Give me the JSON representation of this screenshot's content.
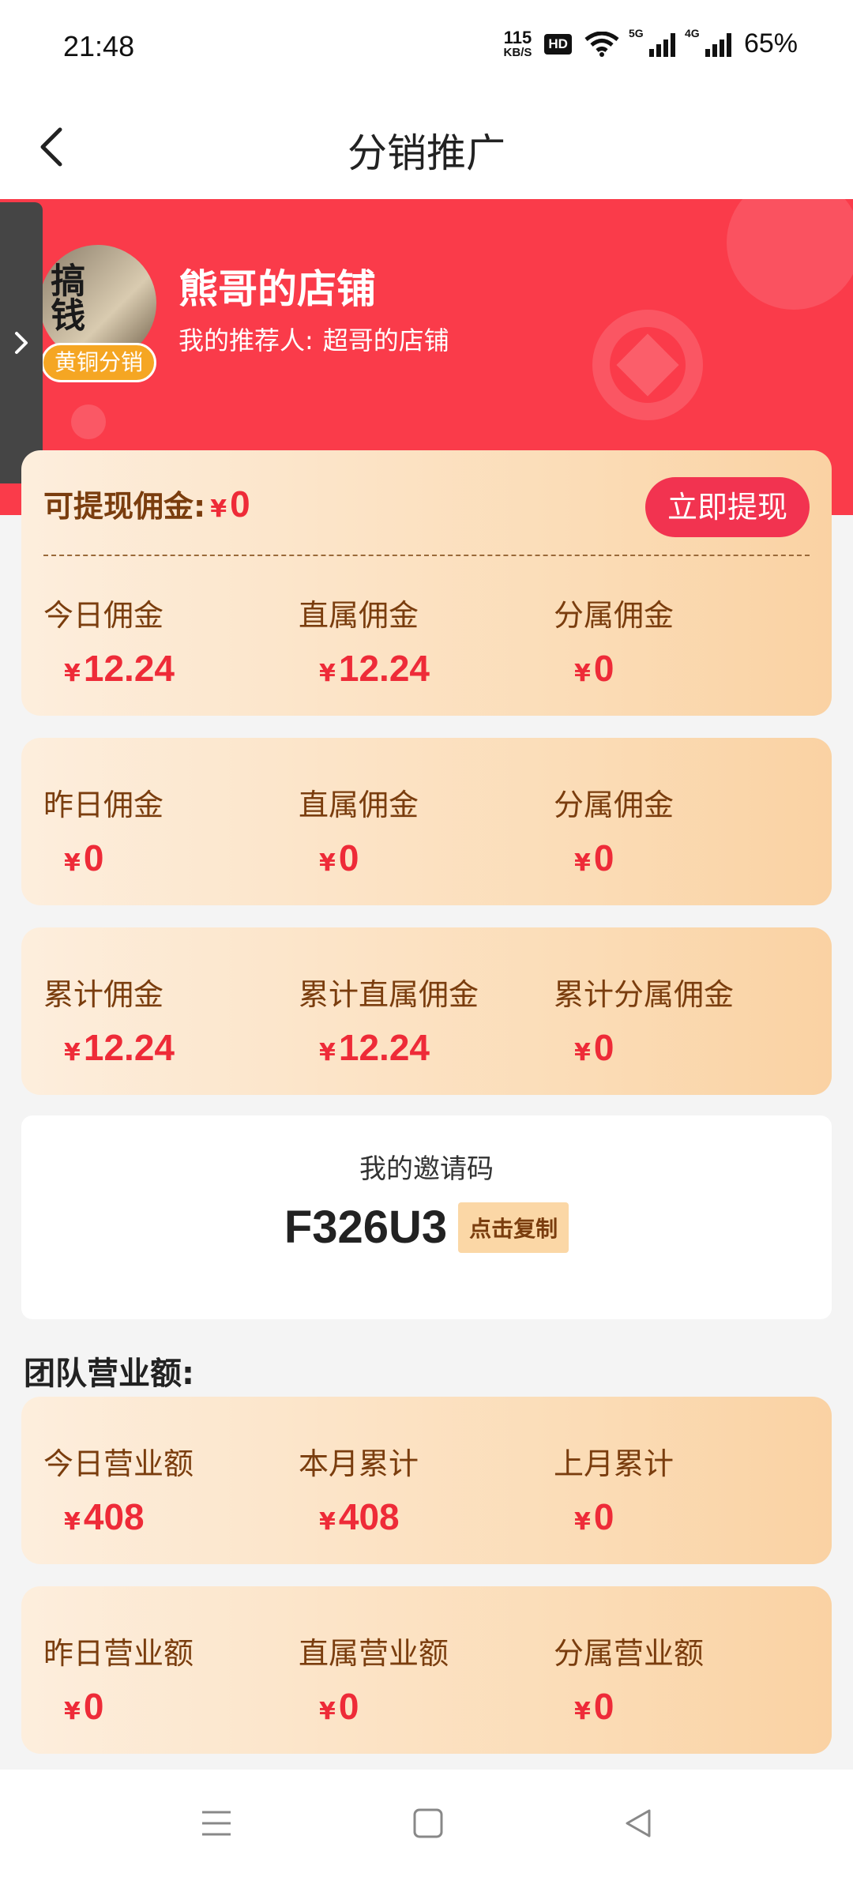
{
  "status_bar": {
    "time": "21:48",
    "net_speed": "115",
    "net_unit": "KB/S",
    "hd": "HD",
    "sig1": "5G",
    "sig2": "4G",
    "battery": "65%"
  },
  "navbar": {
    "title": "分销推广",
    "back_icon": "chevron-left-icon"
  },
  "profile": {
    "shop_name": "熊哥的店铺",
    "referrer_label": "我的推荐人:",
    "referrer_name": "超哥的店铺",
    "level_badge": "黄铜分销",
    "avatar_text": "搞钱"
  },
  "currency": "¥",
  "withdraw": {
    "label": "可提现佣金",
    "colon": ":",
    "amount": "0",
    "button": "立即提现"
  },
  "commission_cards": [
    [
      {
        "label": "今日佣金",
        "value": "12.24"
      },
      {
        "label": "直属佣金",
        "value": "12.24"
      },
      {
        "label": "分属佣金",
        "value": "0"
      }
    ],
    [
      {
        "label": "昨日佣金",
        "value": "0"
      },
      {
        "label": "直属佣金",
        "value": "0"
      },
      {
        "label": "分属佣金",
        "value": "0"
      }
    ],
    [
      {
        "label": "累计佣金",
        "value": "12.24"
      },
      {
        "label": "累计直属佣金",
        "value": "12.24"
      },
      {
        "label": "累计分属佣金",
        "value": "0"
      }
    ]
  ],
  "invite": {
    "title": "我的邀请码",
    "code": "F326U3",
    "copy_button": "点击复制"
  },
  "team": {
    "title": "团队营业额:",
    "cards": [
      [
        {
          "label": "今日营业额",
          "value": "408"
        },
        {
          "label": "本月累计",
          "value": "408"
        },
        {
          "label": "上月累计",
          "value": "0"
        }
      ],
      [
        {
          "label": "昨日营业额",
          "value": "0"
        },
        {
          "label": "直属营业额",
          "value": "0"
        },
        {
          "label": "分属营业额",
          "value": "0"
        }
      ]
    ]
  },
  "colors": {
    "brand_red": "#fa3b4a",
    "money_red": "#ee2b38",
    "label_brown": "#7a3d0e",
    "badge_gold": "#f5a623"
  }
}
